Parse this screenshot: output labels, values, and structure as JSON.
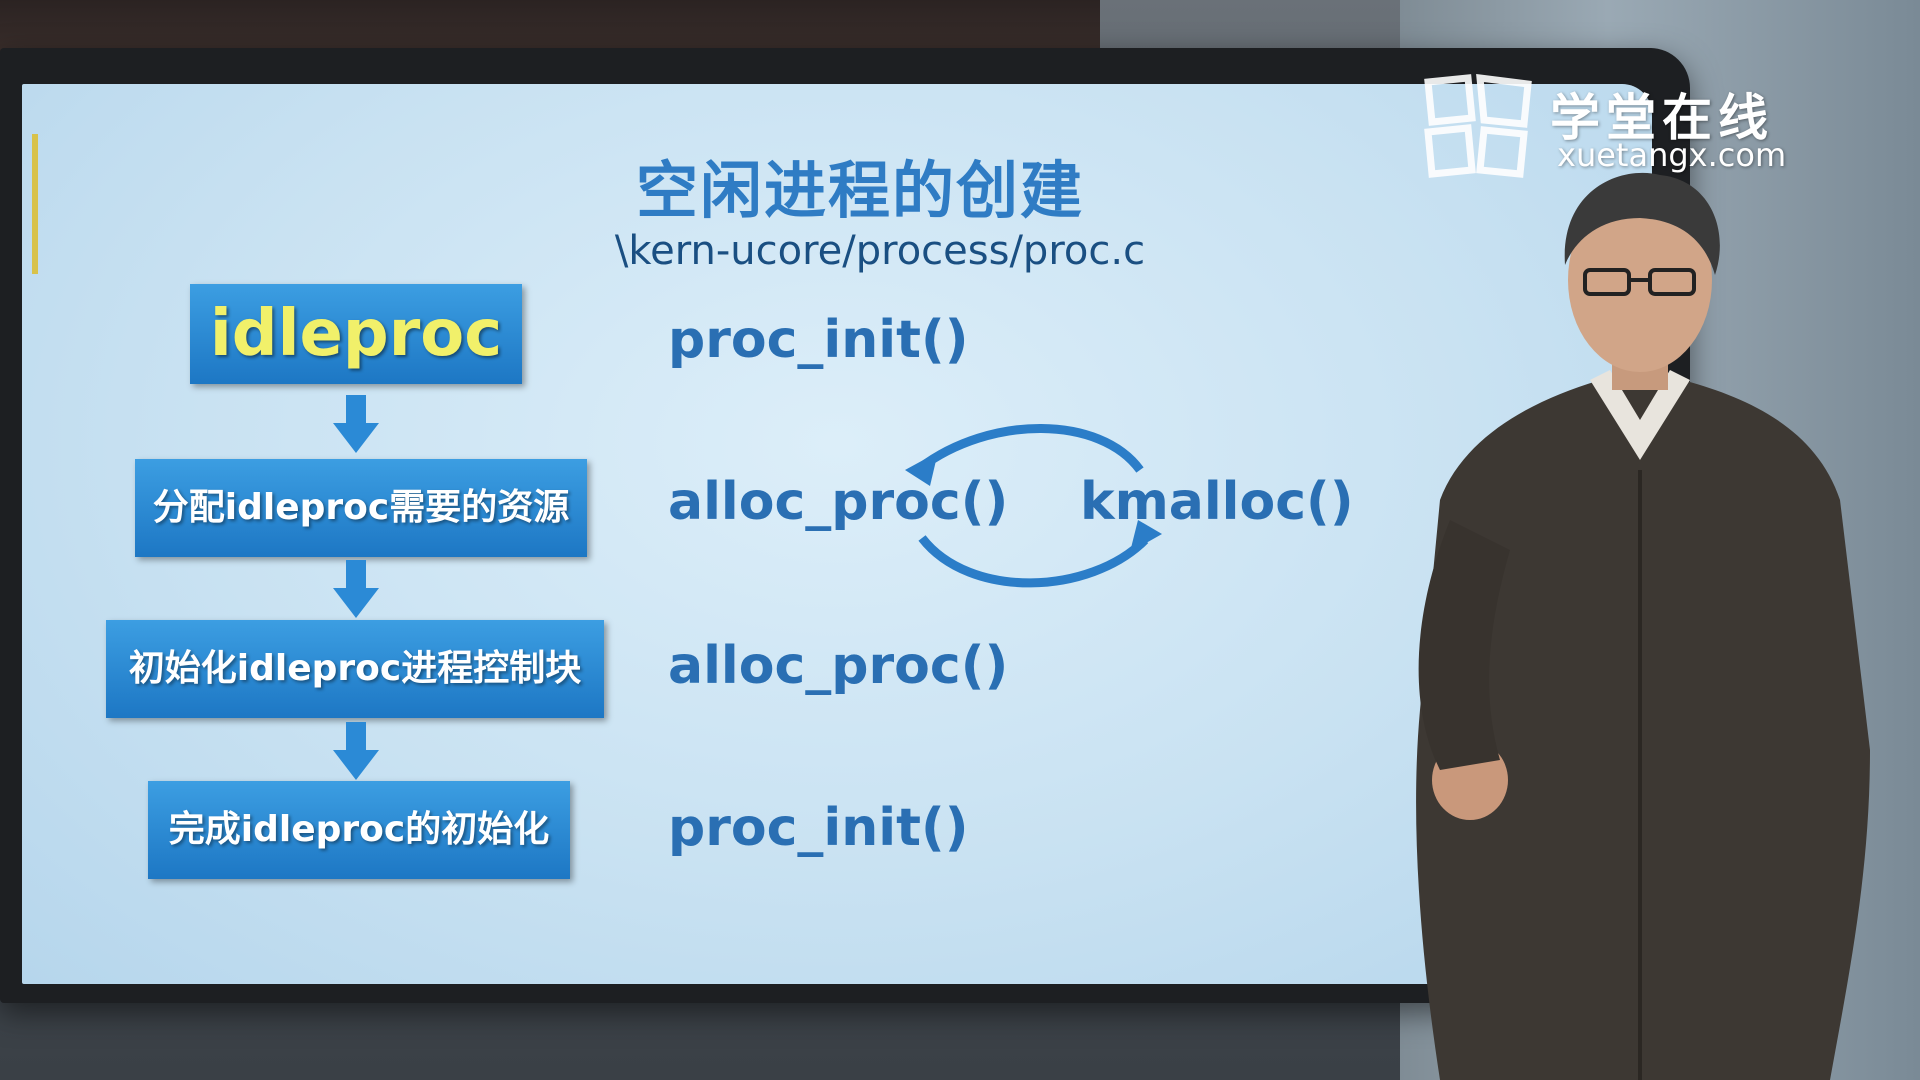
{
  "slide": {
    "title": "空闲进程的创建",
    "subtitle": "\\kern-ucore/process/proc.c",
    "flow": {
      "main": "idleproc",
      "steps": [
        {
          "label": "分配idleproc需要的资源"
        },
        {
          "label": "初始化idleproc进程控制块"
        },
        {
          "label": "完成idleproc的初始化"
        }
      ]
    },
    "functions": {
      "f1": "proc_init()",
      "f2": "alloc_proc()",
      "f3": "kmalloc()",
      "f4": "alloc_proc()",
      "f5": "proc_init()"
    }
  },
  "watermark": {
    "cn": "学堂在线",
    "en": "xuetangx.com"
  },
  "colors": {
    "box_blue": "#2a86d0",
    "title_blue": "#2f7cc4",
    "main_text_yellow": "#f1f06a",
    "function_text": "#2a6fb3"
  },
  "icons": {
    "flow_arrow": "down-arrow-icon",
    "cycle_arrows": "cycle-arrows-icon",
    "logo": "xuetangx-logo-icon"
  }
}
